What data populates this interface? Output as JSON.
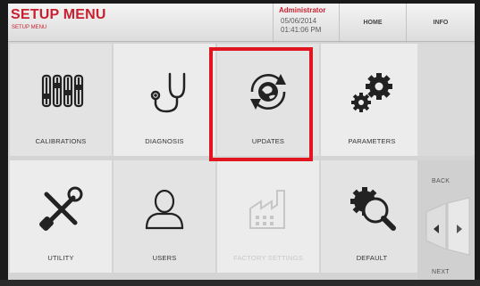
{
  "header": {
    "title": "SETUP MENU",
    "subtitle": "SETUP MENU",
    "user": "Administrator",
    "date": "05/06/2014",
    "time": "01:41:06 PM",
    "home_label": "HOME",
    "info_label": "INFO"
  },
  "tiles": [
    {
      "label": "CALIBRATIONS",
      "icon": "sliders-icon"
    },
    {
      "label": "DIAGNOSIS",
      "icon": "stethoscope-icon"
    },
    {
      "label": "UPDATES",
      "icon": "globe-refresh-icon"
    },
    {
      "label": "PARAMETERS",
      "icon": "gears-icon"
    },
    {
      "label": "UTILITY",
      "icon": "tools-icon"
    },
    {
      "label": "USERS",
      "icon": "user-icon"
    },
    {
      "label": "FACTORY SETTINGS",
      "icon": "factory-icon"
    },
    {
      "label": "DEFAULT",
      "icon": "gear-search-icon"
    }
  ],
  "nav": {
    "back_label": "BACK",
    "next_label": "NEXT"
  },
  "colors": {
    "brand_red": "#c8202f",
    "highlight_red": "#e1151f"
  }
}
